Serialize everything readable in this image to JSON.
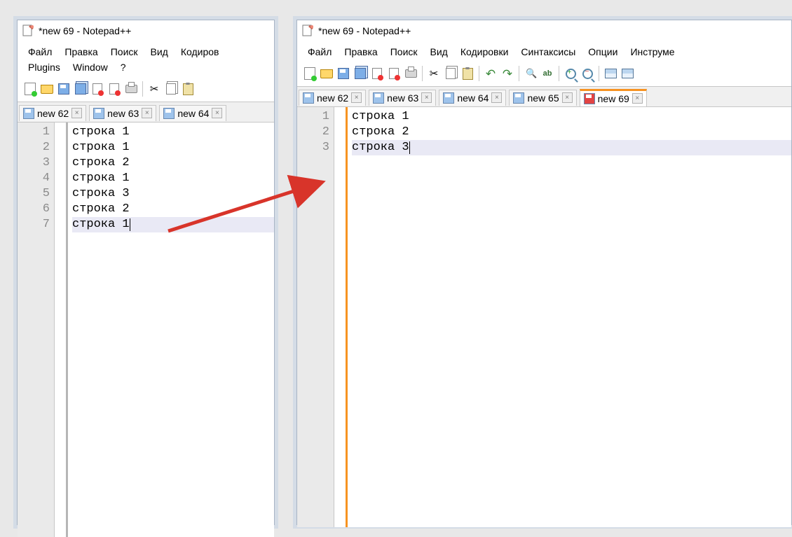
{
  "left": {
    "title": "*new 69 - Notepad++",
    "menu": [
      "Файл",
      "Правка",
      "Поиск",
      "Вид",
      "Кодиров",
      "Plugins",
      "Window",
      "?"
    ],
    "tabs": [
      {
        "label": "new 62"
      },
      {
        "label": "new 63"
      },
      {
        "label": "new 64"
      }
    ],
    "lines": [
      "строка 1",
      "строка 1",
      "строка 2",
      "строка 1",
      "строка 3",
      "строка 2",
      "строка 1"
    ],
    "linenos": [
      "1",
      "2",
      "3",
      "4",
      "5",
      "6",
      "7"
    ],
    "highlight_line": 7
  },
  "right": {
    "title": "*new 69 - Notepad++",
    "menu": [
      "Файл",
      "Правка",
      "Поиск",
      "Вид",
      "Кодировки",
      "Синтаксисы",
      "Опции",
      "Инструме"
    ],
    "tabs": [
      {
        "label": "new 62"
      },
      {
        "label": "new 63"
      },
      {
        "label": "new 64"
      },
      {
        "label": "new 65"
      },
      {
        "label": "new 69",
        "active": true
      }
    ],
    "lines": [
      "строка 1",
      "строка 2",
      "строка 3"
    ],
    "linenos": [
      "1",
      "2",
      "3"
    ],
    "highlight_line": 3
  },
  "toolbar_icons": [
    "new",
    "open",
    "save",
    "saveall",
    "close",
    "closeall",
    "print",
    "cut",
    "copy",
    "paste",
    "undo",
    "redo",
    "find",
    "replace",
    "zoomin",
    "zoomout",
    "chunk1",
    "chunk2"
  ]
}
